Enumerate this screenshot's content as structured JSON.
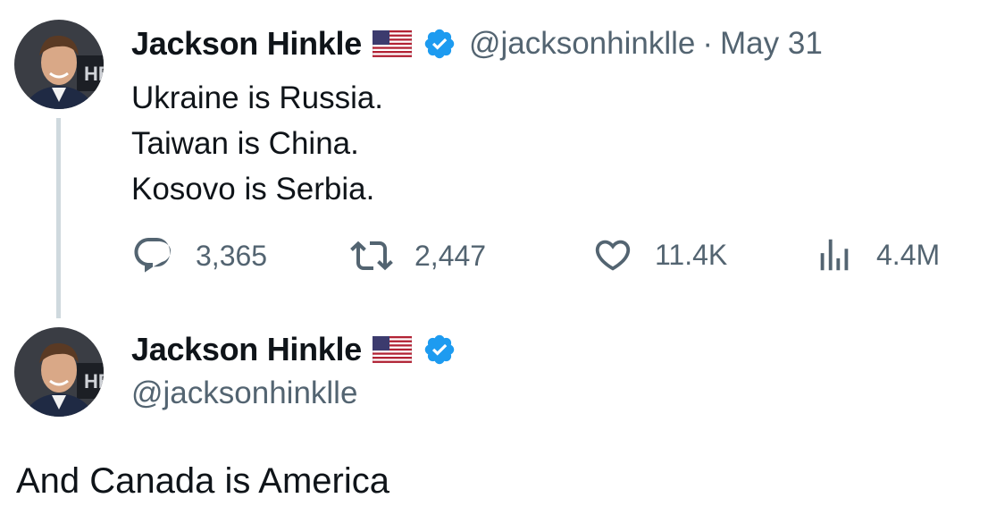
{
  "tweet": {
    "author_name": "Jackson Hinkle",
    "flag_icon": "us-flag-icon",
    "verified_icon": "verified-badge-icon",
    "handle": "@jacksonhinklle",
    "separator": "·",
    "date": "May 31",
    "text_lines": [
      "Ukraine is Russia.",
      "Taiwan is China.",
      "Kosovo is Serbia."
    ],
    "actions": {
      "replies": "3,365",
      "retweets": "2,447",
      "likes": "11.4K",
      "views": "4.4M"
    }
  },
  "reply": {
    "author_name": "Jackson Hinkle",
    "handle": "@jacksonhinklle",
    "text": "And Canada is America"
  },
  "colors": {
    "text": "#0f1419",
    "secondary": "#536471",
    "verified": "#1d9bf0",
    "thread_line": "#cfd9de"
  }
}
